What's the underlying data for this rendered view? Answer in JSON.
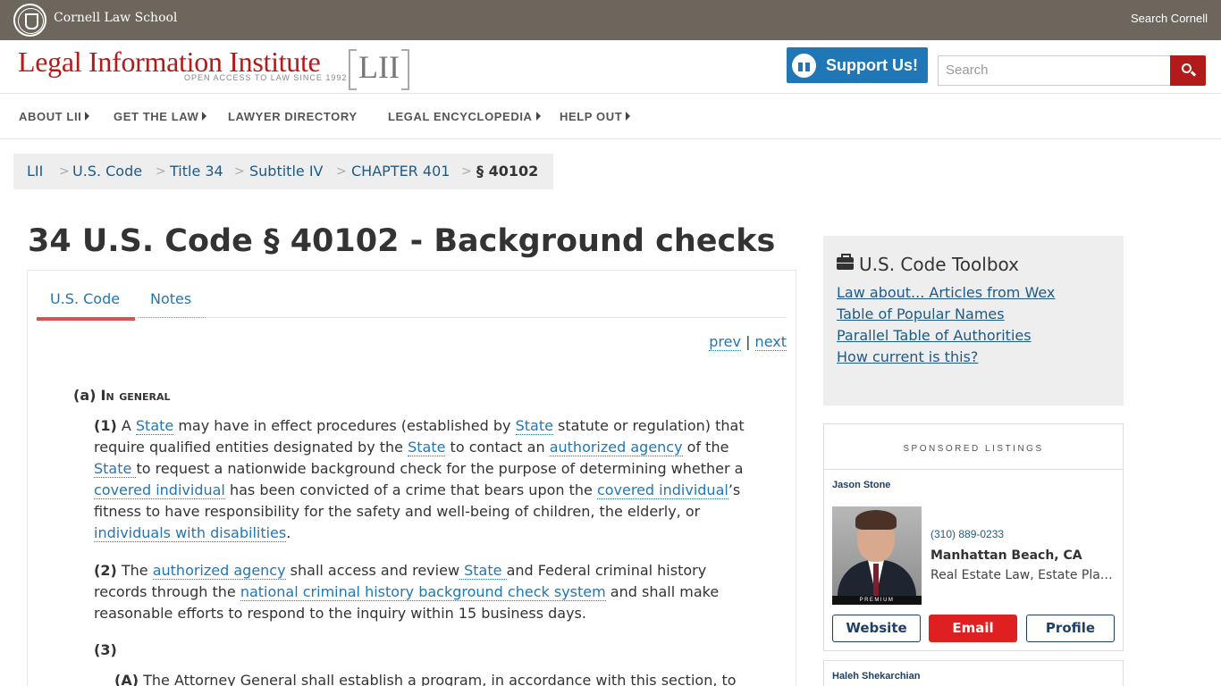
{
  "topbar": {
    "org": "Cornell Law School",
    "search": "Search Cornell"
  },
  "header": {
    "title": "Legal Information Institute",
    "tagline": "OPEN ACCESS TO LAW SINCE 1992",
    "mark": "LII",
    "support": "Support Us!",
    "search_placeholder": "Search"
  },
  "nav": {
    "items": [
      {
        "label": "ABOUT LII",
        "dropdown": true
      },
      {
        "label": "GET THE LAW",
        "dropdown": true
      },
      {
        "label": "LAWYER DIRECTORY",
        "dropdown": false
      },
      {
        "label": "LEGAL ENCYCLOPEDIA",
        "dropdown": true
      },
      {
        "label": "HELP OUT",
        "dropdown": true
      }
    ]
  },
  "breadcrumb": {
    "items": [
      "LII",
      "U.S. Code",
      "Title 34",
      "Subtitle IV",
      "CHAPTER 401"
    ],
    "separator": ">",
    "current": "§ 40102"
  },
  "page": {
    "title": "34 U.S. Code § 40102 - Background checks",
    "tabs": [
      "U.S. Code",
      "Notes"
    ],
    "prev": "prev",
    "sep": "|",
    "next": "next"
  },
  "content": {
    "a_num": "(a)",
    "a_heading": "In general",
    "p1_num": "(1)",
    "p1": {
      "t1": " A ",
      "l1": "State",
      "t2": " may have in effect procedures (established by ",
      "l2": "State",
      "t3": " statute or regulation) that",
      "t4": "require qualified entities designated by the ",
      "l3": "State",
      "t5": " to contact an ",
      "l4": "authorized agency",
      "t6": " of the",
      "l5": "State ",
      "t7": "to request a nationwide background check for the purpose of determining whether a",
      "l6": "covered individual",
      "t8": " has been convicted of a crime that bears upon the ",
      "l7": "covered individual",
      "t9": "’s",
      "t10": "fitness to have responsibility for the safety and well-being of children, the elderly, or",
      "l8": "individuals with disabilities",
      "t11": "."
    },
    "p2_num": "(2)",
    "p2": {
      "t1": " The ",
      "l1": "authorized agency",
      "t2": " shall access and review",
      "l2": " State ",
      "t3": "and Federal criminal history",
      "t4": "records through the ",
      "l3": "national criminal history background check system",
      "t5": " and shall make",
      "t6": "reasonable efforts to respond to the inquiry within 15 business days."
    },
    "p3_num": "(3)",
    "pA_num": "(A)",
    "pA_text": " The Attorney General shall establish a program, in accordance with this section, to"
  },
  "toolbox": {
    "title": "U.S. Code Toolbox",
    "links": [
      "Law about... Articles from Wex",
      "Table of Popular Names",
      "Parallel Table of Authorities",
      "How current is this?"
    ]
  },
  "sponsored": {
    "heading": "SPONSORED LISTINGS",
    "listing1": {
      "name": "Jason Stone",
      "badge": "PREMIUM",
      "phone": "(310) 889-0233",
      "location": "Manhattan Beach, CA",
      "areas": "Real Estate Law, Estate Planning, Business Law",
      "buttons": [
        "Website",
        "Email",
        "Profile"
      ]
    },
    "listing2": {
      "name": "Haleh Shekarchian"
    }
  },
  "colors": {
    "topbar": "#6d665c",
    "brand_red": "#b31b1b",
    "support_blue": "#1f77b5",
    "link": "#1f77b5",
    "email_red": "#e02020"
  }
}
